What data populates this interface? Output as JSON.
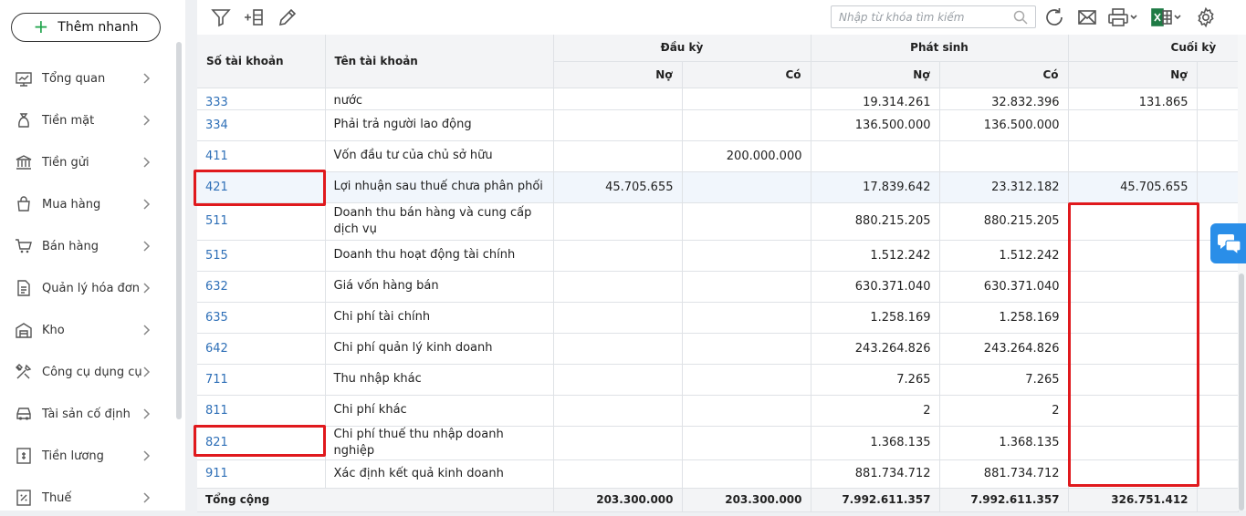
{
  "sidebar": {
    "quick_add_label": "Thêm nhanh",
    "items": [
      {
        "label": "Tổng quan",
        "icon": "dashboard-icon"
      },
      {
        "label": "Tiền mặt",
        "icon": "money-bag-icon"
      },
      {
        "label": "Tiền gửi",
        "icon": "bank-icon"
      },
      {
        "label": "Mua hàng",
        "icon": "shopping-bag-icon"
      },
      {
        "label": "Bán hàng",
        "icon": "cart-icon"
      },
      {
        "label": "Quản lý hóa đơn",
        "icon": "invoice-icon"
      },
      {
        "label": "Kho",
        "icon": "warehouse-icon"
      },
      {
        "label": "Công cụ dụng cụ",
        "icon": "tools-icon"
      },
      {
        "label": "Tài sản cố định",
        "icon": "car-icon"
      },
      {
        "label": "Tiền lương",
        "icon": "salary-icon"
      },
      {
        "label": "Thuế",
        "icon": "tax-icon"
      }
    ]
  },
  "toolbar": {
    "search_placeholder": "Nhập từ khóa tìm kiếm"
  },
  "table": {
    "headers": {
      "account_no": "Số tài khoản",
      "account_name": "Tên tài khoản",
      "opening": "Đầu kỳ",
      "movement": "Phát sinh",
      "closing": "Cuối kỳ",
      "debit": "Nợ",
      "credit": "Có"
    },
    "rows": [
      {
        "acct": "333",
        "name": "nước",
        "od": "",
        "oc": "",
        "md": "19.314.261",
        "mc": "32.832.396",
        "cd": "131.865"
      },
      {
        "acct": "334",
        "name": "Phải trả người lao động",
        "od": "",
        "oc": "",
        "md": "136.500.000",
        "mc": "136.500.000",
        "cd": ""
      },
      {
        "acct": "411",
        "name": "Vốn đầu tư của chủ sở hữu",
        "od": "",
        "oc": "200.000.000",
        "md": "",
        "mc": "",
        "cd": ""
      },
      {
        "acct": "421",
        "name": "Lợi nhuận sau thuế chưa phân phối",
        "od": "45.705.655",
        "oc": "",
        "md": "17.839.642",
        "mc": "23.312.182",
        "cd": "45.705.655"
      },
      {
        "acct": "511",
        "name": "Doanh thu bán hàng và cung cấp dịch vụ",
        "od": "",
        "oc": "",
        "md": "880.215.205",
        "mc": "880.215.205",
        "cd": ""
      },
      {
        "acct": "515",
        "name": "Doanh thu hoạt động tài chính",
        "od": "",
        "oc": "",
        "md": "1.512.242",
        "mc": "1.512.242",
        "cd": ""
      },
      {
        "acct": "632",
        "name": "Giá vốn hàng bán",
        "od": "",
        "oc": "",
        "md": "630.371.040",
        "mc": "630.371.040",
        "cd": ""
      },
      {
        "acct": "635",
        "name": "Chi phí tài chính",
        "od": "",
        "oc": "",
        "md": "1.258.169",
        "mc": "1.258.169",
        "cd": ""
      },
      {
        "acct": "642",
        "name": "Chi phí quản lý kinh doanh",
        "od": "",
        "oc": "",
        "md": "243.264.826",
        "mc": "243.264.826",
        "cd": ""
      },
      {
        "acct": "711",
        "name": "Thu nhập khác",
        "od": "",
        "oc": "",
        "md": "7.265",
        "mc": "7.265",
        "cd": ""
      },
      {
        "acct": "811",
        "name": "Chi phí khác",
        "od": "",
        "oc": "",
        "md": "2",
        "mc": "2",
        "cd": ""
      },
      {
        "acct": "821",
        "name": "Chi phí thuế thu nhập doanh nghiệp",
        "od": "",
        "oc": "",
        "md": "1.368.135",
        "mc": "1.368.135",
        "cd": ""
      },
      {
        "acct": "911",
        "name": "Xác định kết quả kinh doanh",
        "od": "",
        "oc": "",
        "md": "881.734.712",
        "mc": "881.734.712",
        "cd": ""
      }
    ],
    "total": {
      "label": "Tổng cộng",
      "od": "203.300.000",
      "oc": "203.300.000",
      "md": "7.992.611.357",
      "mc": "7.992.611.357",
      "cd": "326.751.412"
    }
  },
  "colors": {
    "link": "#2e6fb7",
    "highlight": "#e0191d",
    "accent": "#2a8ee8",
    "add": "#1fa34a"
  }
}
